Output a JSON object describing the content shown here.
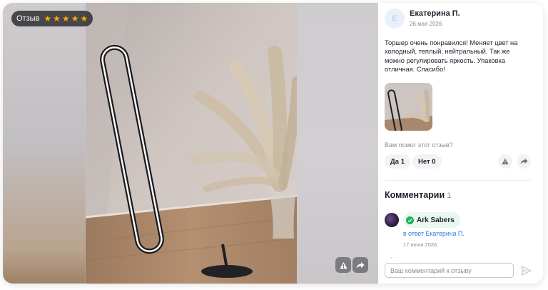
{
  "media": {
    "badge_label": "Отзыв",
    "stars": [
      "★",
      "★",
      "★",
      "★",
      "★"
    ],
    "rating": 5
  },
  "review": {
    "avatar_letter": "Е",
    "author": "Екатерина П.",
    "date": "26 мая 2026",
    "text": "Торшер очень понравился! Меняет цвет на холодный, теплый, нейтральный. Так же можно регулировать яркость. Упаковка отличная. Спасибо!",
    "helpful_question": "Вам помог этот отзыв?",
    "yes_label": "Да 1",
    "no_label": "Нет 0"
  },
  "comments": {
    "title": "Комментарии",
    "count": "1",
    "items": [
      {
        "author": "Ark Sabers",
        "reply_to": "в ответ Екатерина П.",
        "date": "17 июня 2026"
      }
    ],
    "input_placeholder": "Ваш комментарий к отзыву"
  },
  "colors": {
    "accent_star": "#ffa800",
    "link": "#2d7be5",
    "verified": "#21b05f"
  }
}
